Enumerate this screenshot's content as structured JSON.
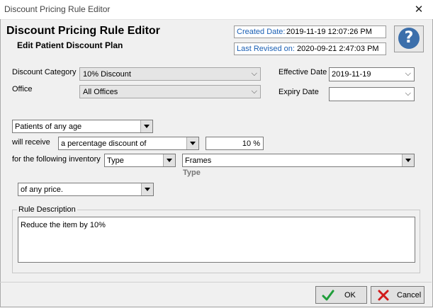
{
  "window": {
    "title": "Discount Pricing Rule Editor",
    "close_glyph": "✕"
  },
  "header": {
    "title": "Discount Pricing Rule Editor",
    "subtitle": "Edit Patient Discount Plan",
    "created_label": "Created Date:",
    "created_value": "2019-11-19 12:07:26 PM",
    "revised_label": "Last Revised on:",
    "revised_value": "2020-09-21 2:47:03 PM",
    "help_glyph": "?"
  },
  "form": {
    "discount_category_label": "Discount Category",
    "discount_category_value": "10% Discount",
    "office_label": "Office",
    "office_value": "All Offices",
    "effective_date_label": "Effective Date",
    "effective_date_value": "2019-11-19",
    "expiry_date_label": "Expiry Date",
    "expiry_date_value": ""
  },
  "rule": {
    "patients_value": "Patients of any age",
    "will_receive_label": "will receive",
    "discount_type_value": "a percentage discount of",
    "discount_amount_value": "10 %",
    "inventory_label": "for the following inventory",
    "inventory_kind_value": "Type",
    "inventory_item_value": "Frames",
    "inventory_item_caption": "Type",
    "price_value": "of any price."
  },
  "description": {
    "group_label": "Rule Description",
    "text": "Reduce the item by 10%"
  },
  "buttons": {
    "ok_label": "OK",
    "cancel_label": "Cancel"
  },
  "icons": {
    "ok_icon": "check-icon",
    "cancel_icon": "x-icon",
    "help_icon": "help-icon"
  },
  "colors": {
    "accent": "#1a5fb4",
    "help": "#3c6fab",
    "ok_check": "#1f9d3a",
    "cancel_x": "#d11a1a"
  }
}
